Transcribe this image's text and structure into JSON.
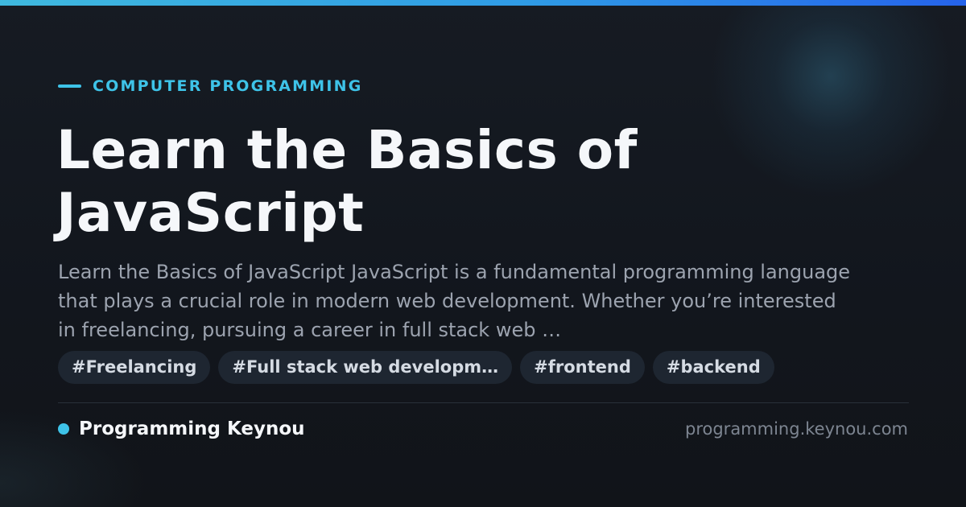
{
  "colors": {
    "accent": "#3ec3e8",
    "background": "#13171e",
    "title": "#f5f7fa",
    "excerpt": "#9ca3af",
    "tag_background": "#1e2631",
    "url": "#7d8591"
  },
  "category": {
    "label": "COMPUTER PROGRAMMING"
  },
  "article": {
    "title_line1": "Learn the Basics of",
    "title_line2": "JavaScript",
    "excerpt": "Learn the Basics of JavaScript JavaScript is a fundamental programming language that plays a crucial role in modern web development. Whether you’re interested in freelancing, pursuing a career in full stack web …"
  },
  "tags": [
    "#Freelancing",
    "#Full stack web developm…",
    "#frontend",
    "#backend"
  ],
  "footer": {
    "brand_name": "Programming Keynou",
    "site_url": "programming.keynou.com"
  }
}
